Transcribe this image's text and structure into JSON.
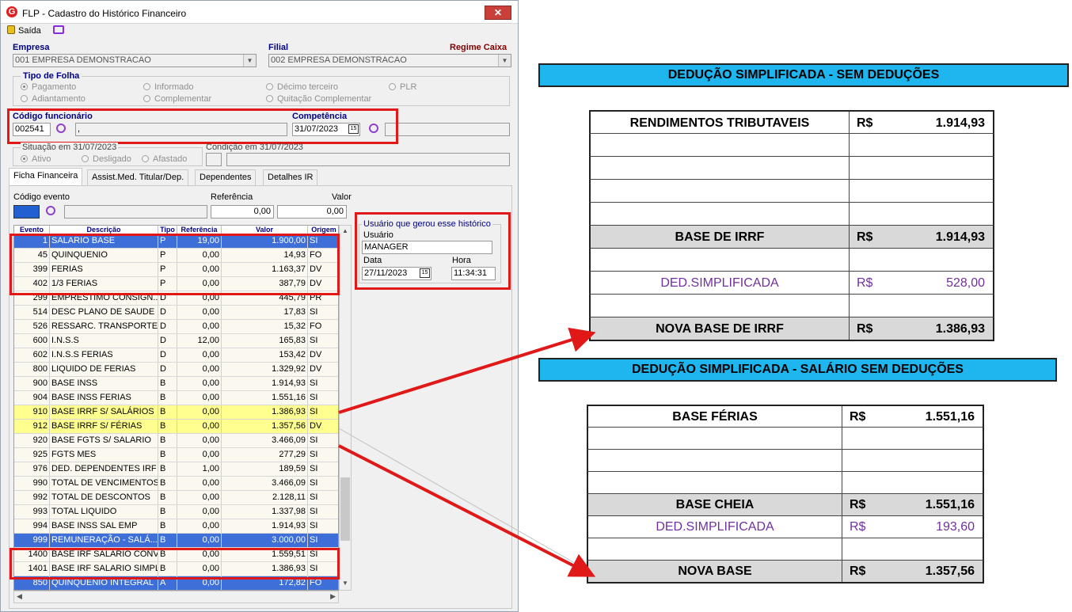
{
  "window": {
    "title": "FLP - Cadastro do Histórico Financeiro",
    "close_label": "✕",
    "toolbar": {
      "exit_label": "Saída"
    }
  },
  "form": {
    "empresa_label": "Empresa",
    "empresa_value": "001 EMPRESA DEMONSTRACAO",
    "filial_label": "Filial",
    "filial_value": "002 EMPRESA DEMONSTRACAO",
    "regime_label": "Regime Caixa",
    "tipo_folha_label": "Tipo de Folha",
    "tipo_folha_options": [
      "Pagamento",
      "Informado",
      "Décimo terceiro",
      "PLR",
      "Adiantamento",
      "Complementar",
      "Quitação Complementar"
    ],
    "codigo_funcionario_label": "Código funcionário",
    "codigo_funcionario_value": "002541",
    "funcionario_name": ",",
    "competencia_label": "Competência",
    "competencia_value": "31/07/2023",
    "situacao_label": "Situação em  31/07/2023",
    "situacao_options": [
      "Ativo",
      "Desligado",
      "Afastado"
    ],
    "condicao_label": "Condição em 31/07/2023"
  },
  "tabs": [
    "Ficha Financeira",
    "Assist.Med. Titular/Dep.",
    "Dependentes",
    "Detalhes IR"
  ],
  "filter": {
    "codigo_evento_label": "Código evento",
    "referencia_label": "Referência",
    "referencia_value": "0,00",
    "valor_label": "Valor",
    "valor_value": "0,00"
  },
  "grid": {
    "headers": [
      "Evento",
      "Descrição",
      "Tipo",
      "Referência",
      "Valor",
      "Origem"
    ],
    "rows": [
      {
        "ev": "1",
        "desc": "SALARIO BASE",
        "tipo": "P",
        "ref": "19,00",
        "val": "1.900,00",
        "orig": "SI",
        "style": "sel"
      },
      {
        "ev": "45",
        "desc": "QUINQUENIO",
        "tipo": "P",
        "ref": "0,00",
        "val": "14,93",
        "orig": "FO",
        "style": "alt"
      },
      {
        "ev": "399",
        "desc": "FERIAS",
        "tipo": "P",
        "ref": "0,00",
        "val": "1.163,37",
        "orig": "DV",
        "style": "alt"
      },
      {
        "ev": "402",
        "desc": "1/3 FERIAS",
        "tipo": "P",
        "ref": "0,00",
        "val": "387,79",
        "orig": "DV",
        "style": "alt"
      },
      {
        "ev": "299",
        "desc": "EMPRESTIMO CONSIGN...",
        "tipo": "D",
        "ref": "0,00",
        "val": "445,79",
        "orig": "PR",
        "style": "alt"
      },
      {
        "ev": "514",
        "desc": "DESC PLANO DE SAUDE",
        "tipo": "D",
        "ref": "0,00",
        "val": "17,83",
        "orig": "SI",
        "style": "alt"
      },
      {
        "ev": "526",
        "desc": "RESSARC. TRANSPORTE",
        "tipo": "D",
        "ref": "0,00",
        "val": "15,32",
        "orig": "FO",
        "style": "alt"
      },
      {
        "ev": "600",
        "desc": "I.N.S.S",
        "tipo": "D",
        "ref": "12,00",
        "val": "165,83",
        "orig": "SI",
        "style": "alt"
      },
      {
        "ev": "602",
        "desc": "I.N.S.S FERIAS",
        "tipo": "D",
        "ref": "0,00",
        "val": "153,42",
        "orig": "DV",
        "style": "alt"
      },
      {
        "ev": "800",
        "desc": "LIQUIDO DE FERIAS",
        "tipo": "D",
        "ref": "0,00",
        "val": "1.329,92",
        "orig": "DV",
        "style": "alt"
      },
      {
        "ev": "900",
        "desc": "BASE INSS",
        "tipo": "B",
        "ref": "0,00",
        "val": "1.914,93",
        "orig": "SI",
        "style": "alt"
      },
      {
        "ev": "904",
        "desc": "BASE INSS FERIAS",
        "tipo": "B",
        "ref": "0,00",
        "val": "1.551,16",
        "orig": "SI",
        "style": "alt"
      },
      {
        "ev": "910",
        "desc": "BASE IRRF S/ SALÁRIOS",
        "tipo": "B",
        "ref": "0,00",
        "val": "1.386,93",
        "orig": "SI",
        "style": "yel"
      },
      {
        "ev": "912",
        "desc": "BASE IRRF S/ FÉRIAS",
        "tipo": "B",
        "ref": "0,00",
        "val": "1.357,56",
        "orig": "DV",
        "style": "yel"
      },
      {
        "ev": "920",
        "desc": "BASE FGTS S/ SALARIO",
        "tipo": "B",
        "ref": "0,00",
        "val": "3.466,09",
        "orig": "SI",
        "style": "alt"
      },
      {
        "ev": "925",
        "desc": "FGTS MES",
        "tipo": "B",
        "ref": "0,00",
        "val": "277,29",
        "orig": "SI",
        "style": "alt"
      },
      {
        "ev": "976",
        "desc": "DED. DEPENDENTES IRF",
        "tipo": "B",
        "ref": "1,00",
        "val": "189,59",
        "orig": "SI",
        "style": "alt"
      },
      {
        "ev": "990",
        "desc": "TOTAL DE VENCIMENTOS",
        "tipo": "B",
        "ref": "0,00",
        "val": "3.466,09",
        "orig": "SI",
        "style": "alt"
      },
      {
        "ev": "992",
        "desc": "TOTAL DE DESCONTOS",
        "tipo": "B",
        "ref": "0,00",
        "val": "2.128,11",
        "orig": "SI",
        "style": "alt"
      },
      {
        "ev": "993",
        "desc": "TOTAL LIQUIDO",
        "tipo": "B",
        "ref": "0,00",
        "val": "1.337,98",
        "orig": "SI",
        "style": "alt"
      },
      {
        "ev": "994",
        "desc": "BASE INSS SAL EMP",
        "tipo": "B",
        "ref": "0,00",
        "val": "1.914,93",
        "orig": "SI",
        "style": "alt"
      },
      {
        "ev": "999",
        "desc": "REMUNERAÇÃO - SALÁ...",
        "tipo": "B",
        "ref": "0,00",
        "val": "3.000,00",
        "orig": "SI",
        "style": "sel"
      },
      {
        "ev": "1400",
        "desc": "BASE IRF  SALARIO CONV",
        "tipo": "B",
        "ref": "0,00",
        "val": "1.559,51",
        "orig": "SI",
        "style": "alt"
      },
      {
        "ev": "1401",
        "desc": "BASE IRF SALARIO SIMPL",
        "tipo": "B",
        "ref": "0,00",
        "val": "1.386,93",
        "orig": "SI",
        "style": "alt"
      },
      {
        "ev": "850",
        "desc": "QUINQUENIO INTEGRAL",
        "tipo": "A",
        "ref": "0,00",
        "val": "172,82",
        "orig": "FO",
        "style": "sel"
      }
    ]
  },
  "user_panel": {
    "header": "Usuário que gerou esse histórico",
    "usuario_label": "Usuário",
    "usuario_value": "MANAGER",
    "data_label": "Data",
    "data_value": "27/11/2023",
    "hora_label": "Hora",
    "hora_value": "11:34:31"
  },
  "table1": {
    "banner": "DEDUÇÃO SIMPLIFICADA - SEM DEDUÇÕES",
    "rows": [
      {
        "label": "RENDIMENTOS TRIBUTAVEIS",
        "cur": "R$",
        "val": "1.914,93",
        "kind": "bold"
      },
      {
        "label": "",
        "cur": "",
        "val": "",
        "kind": "blank"
      },
      {
        "label": "",
        "cur": "",
        "val": "",
        "kind": "blank"
      },
      {
        "label": "",
        "cur": "",
        "val": "",
        "kind": "blank"
      },
      {
        "label": "",
        "cur": "",
        "val": "",
        "kind": "blank"
      },
      {
        "label": "BASE DE IRRF",
        "cur": "R$",
        "val": "1.914,93",
        "kind": "gray"
      },
      {
        "label": "",
        "cur": "",
        "val": "",
        "kind": "blank"
      },
      {
        "label": "DED.SIMPLIFICADA",
        "cur": "R$",
        "val": "528,00",
        "kind": "purple"
      },
      {
        "label": "",
        "cur": "",
        "val": "",
        "kind": "blank"
      },
      {
        "label": "NOVA BASE DE IRRF",
        "cur": "R$",
        "val": "1.386,93",
        "kind": "gray"
      }
    ]
  },
  "table2": {
    "banner": "DEDUÇÃO SIMPLIFICADA - SALÁRIO SEM DEDUÇÕES",
    "rows": [
      {
        "label": "BASE FÉRIAS",
        "cur": "R$",
        "val": "1.551,16",
        "kind": "bold"
      },
      {
        "label": "",
        "cur": "",
        "val": "",
        "kind": "blank"
      },
      {
        "label": "",
        "cur": "",
        "val": "",
        "kind": "blank"
      },
      {
        "label": "",
        "cur": "",
        "val": "",
        "kind": "blank"
      },
      {
        "label": "BASE CHEIA",
        "cur": "R$",
        "val": "1.551,16",
        "kind": "gray"
      },
      {
        "label": "DED.SIMPLIFICADA",
        "cur": "R$",
        "val": "193,60",
        "kind": "purple"
      },
      {
        "label": "",
        "cur": "",
        "val": "",
        "kind": "blank"
      },
      {
        "label": "NOVA BASE",
        "cur": "R$",
        "val": "1.357,56",
        "kind": "gray"
      }
    ]
  },
  "colors": {
    "highlight_red": "#e01818",
    "banner_blue": "#1fb5ef",
    "selection_blue": "#3e6fd8",
    "yellow_row": "#ffff90",
    "purple_text": "#7030a0"
  }
}
